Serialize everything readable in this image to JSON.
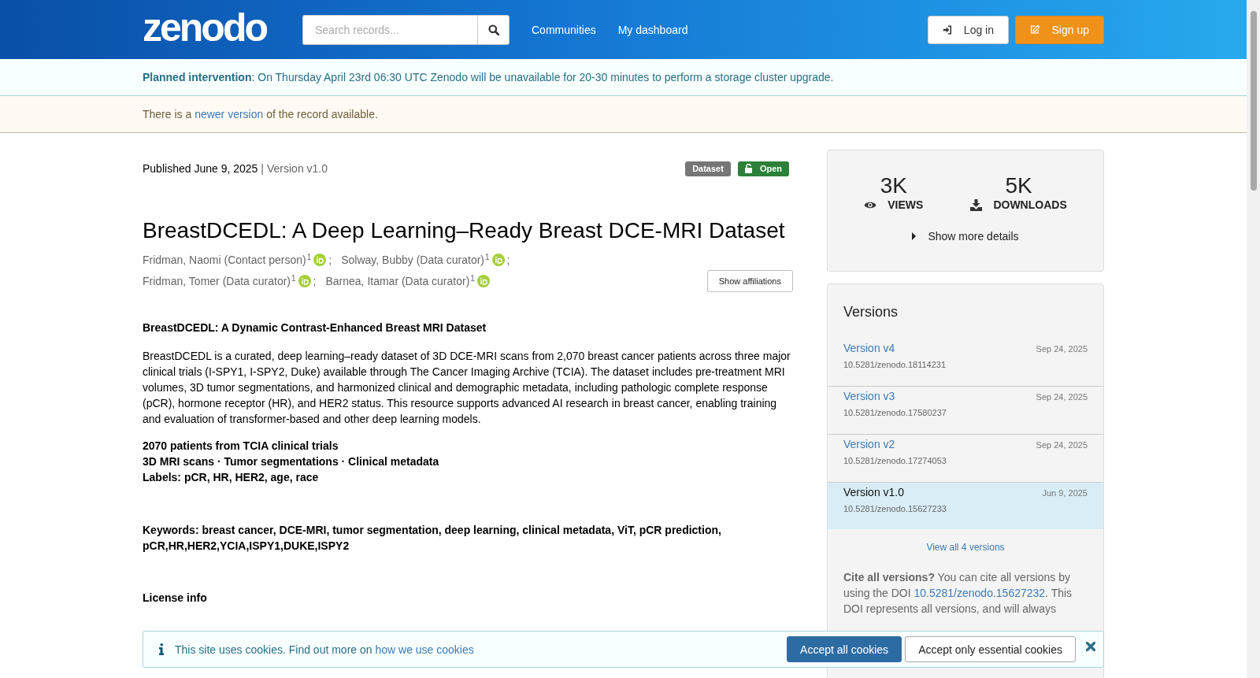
{
  "header": {
    "logo": "zenodo",
    "search_placeholder": "Search records...",
    "nav": [
      "Communities",
      "My dashboard"
    ],
    "login": "Log in",
    "signup": "Sign up"
  },
  "banners": [
    {
      "kind": "info",
      "text": "**Planned intervention**: On Thursday April 23rd 06:30 UTC Zenodo will be unavailable for 20-30 minutes to perform a storage cluster upgrade."
    },
    {
      "kind": "warning",
      "before": "There is a ",
      "link": "newer version",
      "after": " of the record available."
    }
  ],
  "record": {
    "published": "Published June 9, 2025",
    "separator": "|",
    "version": "Version v1.0",
    "badges": [
      {
        "kind": "type",
        "label": "Dataset"
      },
      {
        "kind": "access",
        "label": "Open"
      }
    ],
    "title": "BreastDCEDL: A Deep Learning–Ready Breast DCE-MRI Dataset",
    "creators": [
      {
        "name": "Fridman, Naomi (Contact person)",
        "affiliation": "1",
        "separator": ";"
      },
      {
        "name": "Solway, Bubby (Data curator)",
        "affiliation": "1",
        "separator": ";"
      },
      {
        "name": "Fridman, Tomer (Data curator)",
        "affiliation": "1",
        "separator": ";"
      },
      {
        "name": "Barnea, Itamar (Data curator)",
        "affiliation": "1"
      }
    ],
    "show_affiliations": "Show affiliations",
    "description_heading": "BreastDCEDL: A Dynamic Contrast-Enhanced Breast MRI Dataset",
    "description": "BreastDCEDL is a curated, deep learning–ready dataset of 3D DCE-MRI scans from 2,070 breast cancer patients across three major clinical trials (I-SPY1, I-SPY2, Duke) available through The Cancer Imaging Archive (TCIA). The dataset includes pre-treatment MRI volumes, 3D tumor segmentations, and harmonized clinical and demographic metadata, including pathologic complete response (pCR), hormone receptor (HR), and HER2 status. This resource supports advanced AI research in breast cancer, enabling training and evaluation of transformer-based and other deep learning models.",
    "highlights": [
      "2070 patients from TCIA clinical trials",
      "3D MRI scans · Tumor segmentations · Clinical metadata",
      "Labels: pCR, HR, HER2, age, race"
    ],
    "keywords": "Keywords: breast cancer, DCE-MRI, tumor segmentation, deep learning, clinical metadata, ViT, pCR prediction, pCR,HR,HER2,YCIA,ISPY1,DUKE,ISPY2",
    "license_heading": "License info"
  },
  "stats": {
    "items": [
      {
        "kind": "views",
        "value": "3K",
        "label": "VIEWS"
      },
      {
        "kind": "downloads",
        "value": "5K",
        "label": "DOWNLOADS"
      }
    ],
    "show_more": "Show more details"
  },
  "versions": {
    "title": "Versions",
    "items": [
      {
        "label": "Version v4",
        "date": "Sep 24, 2025",
        "doi": "10.5281/zenodo.18114231",
        "selected": false
      },
      {
        "label": "Version v3",
        "date": "Sep 24, 2025",
        "doi": "10.5281/zenodo.17580237",
        "selected": false
      },
      {
        "label": "Version v2",
        "date": "Sep 24, 2025",
        "doi": "10.5281/zenodo.17274053",
        "selected": false
      },
      {
        "label": "Version v1.0",
        "date": "Jun 9, 2025",
        "doi": "10.5281/zenodo.15627233",
        "selected": true
      }
    ],
    "view_all": "View all 4 versions",
    "cite_bold": "Cite all versions?",
    "cite_before": " You can cite all versions by using the DOI ",
    "cite_link": "10.5281/zenodo.15627232",
    "cite_after": ". This DOI represents all versions, and will always"
  },
  "cookie": {
    "before": "This site uses cookies. Find out more on ",
    "link": "how we use cookies",
    "accept_all": "Accept all cookies",
    "accept_essential": "Accept only essential cookies"
  }
}
